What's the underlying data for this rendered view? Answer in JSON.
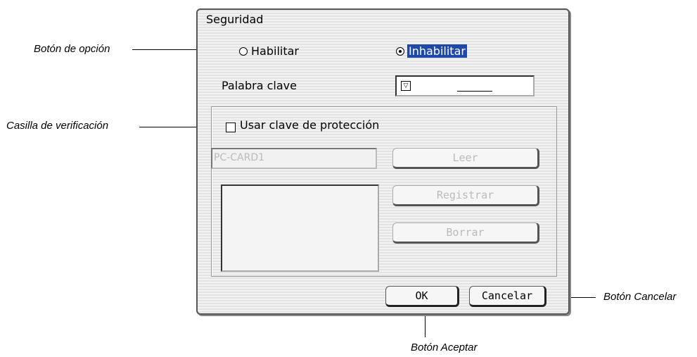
{
  "callouts": {
    "radio": "Botón de opción",
    "checkbox": "Casilla de verificación",
    "cancel": "Botón Cancelar",
    "ok": "Botón Aceptar"
  },
  "dialog": {
    "title": "Seguridad",
    "enable_label": "Habilitar",
    "disable_label": "Inhabilitar",
    "password_label": "Palabra clave",
    "use_protection_label": "Usar clave de protección",
    "card_field_value": "PC-CARD1",
    "read_label": "Leer",
    "register_label": "Registrar",
    "delete_label": "Borrar",
    "ok_label": "OK",
    "cancel_label": "Cancelar",
    "selected_option": "Inhabilitar",
    "protection_checked": false
  }
}
